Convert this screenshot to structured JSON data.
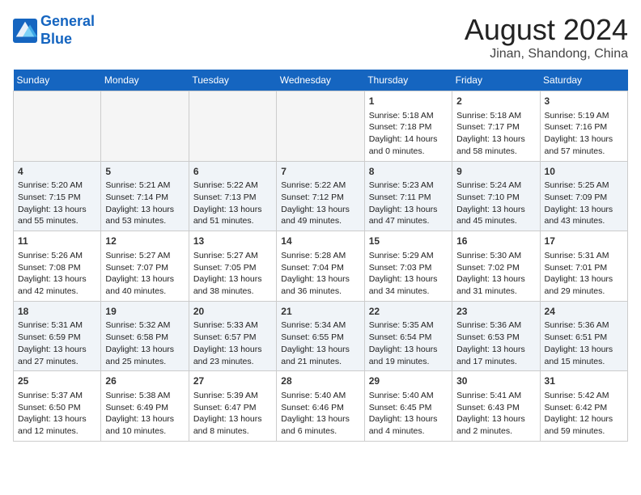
{
  "header": {
    "logo_line1": "General",
    "logo_line2": "Blue",
    "title": "August 2024",
    "subtitle": "Jinan, Shandong, China"
  },
  "weekdays": [
    "Sunday",
    "Monday",
    "Tuesday",
    "Wednesday",
    "Thursday",
    "Friday",
    "Saturday"
  ],
  "weeks": [
    [
      {
        "day": "",
        "info": ""
      },
      {
        "day": "",
        "info": ""
      },
      {
        "day": "",
        "info": ""
      },
      {
        "day": "",
        "info": ""
      },
      {
        "day": "1",
        "info": "Sunrise: 5:18 AM\nSunset: 7:18 PM\nDaylight: 14 hours\nand 0 minutes."
      },
      {
        "day": "2",
        "info": "Sunrise: 5:18 AM\nSunset: 7:17 PM\nDaylight: 13 hours\nand 58 minutes."
      },
      {
        "day": "3",
        "info": "Sunrise: 5:19 AM\nSunset: 7:16 PM\nDaylight: 13 hours\nand 57 minutes."
      }
    ],
    [
      {
        "day": "4",
        "info": "Sunrise: 5:20 AM\nSunset: 7:15 PM\nDaylight: 13 hours\nand 55 minutes."
      },
      {
        "day": "5",
        "info": "Sunrise: 5:21 AM\nSunset: 7:14 PM\nDaylight: 13 hours\nand 53 minutes."
      },
      {
        "day": "6",
        "info": "Sunrise: 5:22 AM\nSunset: 7:13 PM\nDaylight: 13 hours\nand 51 minutes."
      },
      {
        "day": "7",
        "info": "Sunrise: 5:22 AM\nSunset: 7:12 PM\nDaylight: 13 hours\nand 49 minutes."
      },
      {
        "day": "8",
        "info": "Sunrise: 5:23 AM\nSunset: 7:11 PM\nDaylight: 13 hours\nand 47 minutes."
      },
      {
        "day": "9",
        "info": "Sunrise: 5:24 AM\nSunset: 7:10 PM\nDaylight: 13 hours\nand 45 minutes."
      },
      {
        "day": "10",
        "info": "Sunrise: 5:25 AM\nSunset: 7:09 PM\nDaylight: 13 hours\nand 43 minutes."
      }
    ],
    [
      {
        "day": "11",
        "info": "Sunrise: 5:26 AM\nSunset: 7:08 PM\nDaylight: 13 hours\nand 42 minutes."
      },
      {
        "day": "12",
        "info": "Sunrise: 5:27 AM\nSunset: 7:07 PM\nDaylight: 13 hours\nand 40 minutes."
      },
      {
        "day": "13",
        "info": "Sunrise: 5:27 AM\nSunset: 7:05 PM\nDaylight: 13 hours\nand 38 minutes."
      },
      {
        "day": "14",
        "info": "Sunrise: 5:28 AM\nSunset: 7:04 PM\nDaylight: 13 hours\nand 36 minutes."
      },
      {
        "day": "15",
        "info": "Sunrise: 5:29 AM\nSunset: 7:03 PM\nDaylight: 13 hours\nand 34 minutes."
      },
      {
        "day": "16",
        "info": "Sunrise: 5:30 AM\nSunset: 7:02 PM\nDaylight: 13 hours\nand 31 minutes."
      },
      {
        "day": "17",
        "info": "Sunrise: 5:31 AM\nSunset: 7:01 PM\nDaylight: 13 hours\nand 29 minutes."
      }
    ],
    [
      {
        "day": "18",
        "info": "Sunrise: 5:31 AM\nSunset: 6:59 PM\nDaylight: 13 hours\nand 27 minutes."
      },
      {
        "day": "19",
        "info": "Sunrise: 5:32 AM\nSunset: 6:58 PM\nDaylight: 13 hours\nand 25 minutes."
      },
      {
        "day": "20",
        "info": "Sunrise: 5:33 AM\nSunset: 6:57 PM\nDaylight: 13 hours\nand 23 minutes."
      },
      {
        "day": "21",
        "info": "Sunrise: 5:34 AM\nSunset: 6:55 PM\nDaylight: 13 hours\nand 21 minutes."
      },
      {
        "day": "22",
        "info": "Sunrise: 5:35 AM\nSunset: 6:54 PM\nDaylight: 13 hours\nand 19 minutes."
      },
      {
        "day": "23",
        "info": "Sunrise: 5:36 AM\nSunset: 6:53 PM\nDaylight: 13 hours\nand 17 minutes."
      },
      {
        "day": "24",
        "info": "Sunrise: 5:36 AM\nSunset: 6:51 PM\nDaylight: 13 hours\nand 15 minutes."
      }
    ],
    [
      {
        "day": "25",
        "info": "Sunrise: 5:37 AM\nSunset: 6:50 PM\nDaylight: 13 hours\nand 12 minutes."
      },
      {
        "day": "26",
        "info": "Sunrise: 5:38 AM\nSunset: 6:49 PM\nDaylight: 13 hours\nand 10 minutes."
      },
      {
        "day": "27",
        "info": "Sunrise: 5:39 AM\nSunset: 6:47 PM\nDaylight: 13 hours\nand 8 minutes."
      },
      {
        "day": "28",
        "info": "Sunrise: 5:40 AM\nSunset: 6:46 PM\nDaylight: 13 hours\nand 6 minutes."
      },
      {
        "day": "29",
        "info": "Sunrise: 5:40 AM\nSunset: 6:45 PM\nDaylight: 13 hours\nand 4 minutes."
      },
      {
        "day": "30",
        "info": "Sunrise: 5:41 AM\nSunset: 6:43 PM\nDaylight: 13 hours\nand 2 minutes."
      },
      {
        "day": "31",
        "info": "Sunrise: 5:42 AM\nSunset: 6:42 PM\nDaylight: 12 hours\nand 59 minutes."
      }
    ]
  ]
}
